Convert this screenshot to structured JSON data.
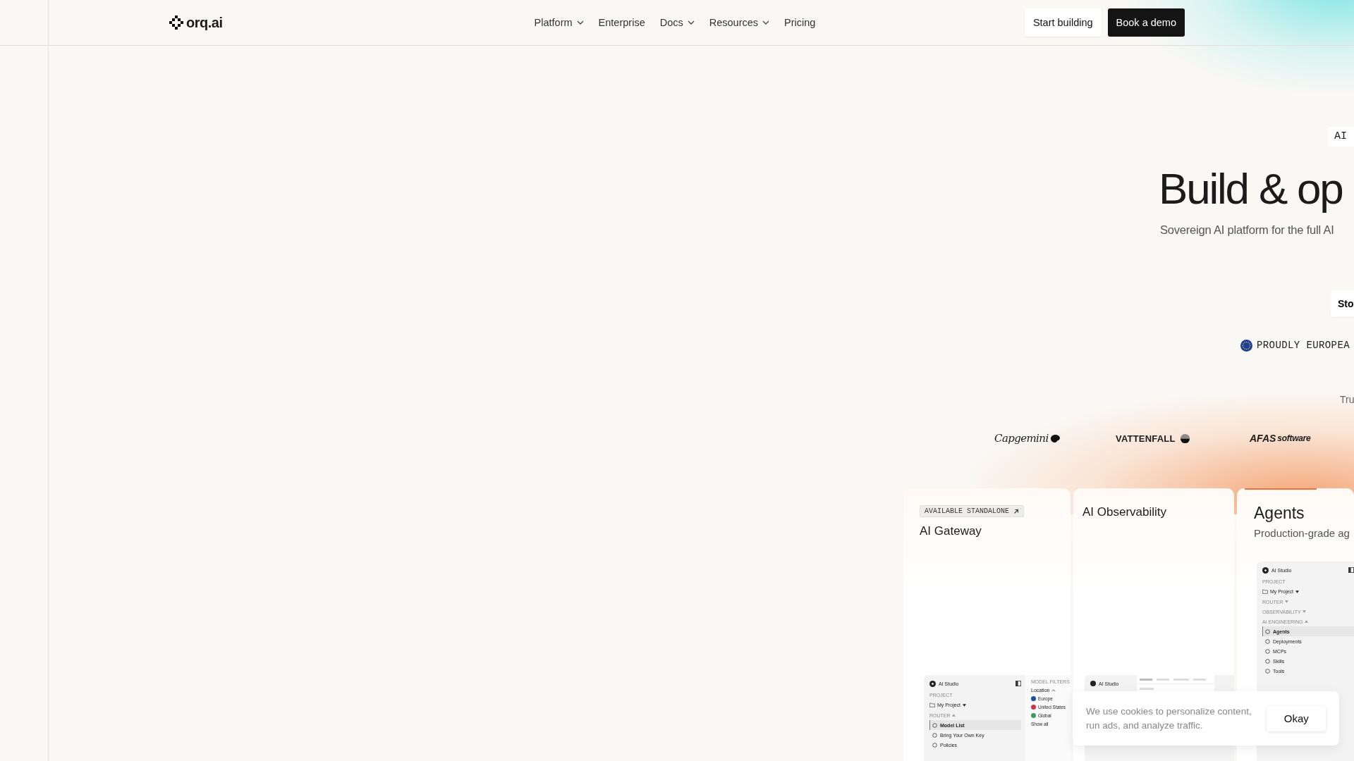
{
  "header": {
    "logo": "orq.ai",
    "nav": [
      {
        "label": "Platform",
        "dropdown": true
      },
      {
        "label": "Enterprise",
        "dropdown": false
      },
      {
        "label": "Docs",
        "dropdown": true
      },
      {
        "label": "Resources",
        "dropdown": true
      },
      {
        "label": "Pricing",
        "dropdown": false
      }
    ],
    "buttons": [
      {
        "label": "Start building",
        "kind": "secondary"
      },
      {
        "label": "Book a demo",
        "kind": "primary"
      }
    ]
  },
  "hero": {
    "badge": "AI",
    "title": "Build & op",
    "subtitle": "Sovereign AI platform for the full AI",
    "button": "Sto",
    "eu_label": "PROUDLY EUROPEA",
    "trusted_label": "Tru",
    "logos": [
      {
        "kind": "capgemini",
        "name": "Capgemini"
      },
      {
        "kind": "vattenfall",
        "name": "VATTENFALL"
      },
      {
        "kind": "afas",
        "name": "AFAS",
        "suffix": "software"
      }
    ]
  },
  "cards": [
    {
      "badge": "AVAILABLE STANDALONE",
      "title": "AI Gateway",
      "selected": false,
      "preview": {
        "kind": "models",
        "app": "AI Studio",
        "sidebar": [
          {
            "kind": "section",
            "label": "PROJECT"
          },
          {
            "kind": "project",
            "label": "My Project"
          },
          {
            "kind": "section",
            "label": "ROUTER",
            "expanded": true
          },
          {
            "kind": "item",
            "label": "Model List",
            "selected": true
          },
          {
            "kind": "item",
            "label": "Bring Your Own Key",
            "selected": false
          },
          {
            "kind": "item",
            "label": "Policies",
            "selected": false
          }
        ],
        "filters": {
          "title": "MODEL FILTERS",
          "group": "Location",
          "options": [
            {
              "label": "Europe",
              "color": "#1d4fa3"
            },
            {
              "label": "United States",
              "color": "#c8374a"
            },
            {
              "label": "Global",
              "color": "#3f9a5b"
            }
          ],
          "more": "Show all"
        }
      }
    },
    {
      "title": "AI Observability",
      "selected": false,
      "preview": {
        "kind": "traces",
        "app": "AI Studio"
      }
    },
    {
      "title": "Agents",
      "subtitle": "Production-grade ag",
      "selected": true,
      "preview": {
        "kind": "sidebar",
        "app": "AI Studio",
        "sidebar": [
          {
            "kind": "section",
            "label": "PROJECT"
          },
          {
            "kind": "project",
            "label": "My Project"
          },
          {
            "kind": "section",
            "label": "ROUTER",
            "expanded": false
          },
          {
            "kind": "section",
            "label": "OBSERVABILITY",
            "expanded": false
          },
          {
            "kind": "section",
            "label": "AI ENGINEERING",
            "expanded": true
          },
          {
            "kind": "item",
            "label": "Agents",
            "selected": true
          },
          {
            "kind": "item",
            "label": "Deployments",
            "selected": false
          },
          {
            "kind": "item",
            "label": "MCPs",
            "selected": false
          },
          {
            "kind": "item",
            "label": "Skills",
            "selected": false
          },
          {
            "kind": "item",
            "label": "Tools",
            "selected": false
          }
        ]
      }
    }
  ],
  "cookie_banner": {
    "text": "We use cookies to personalize content, run ads, and analyze traffic.",
    "button": "Okay"
  }
}
